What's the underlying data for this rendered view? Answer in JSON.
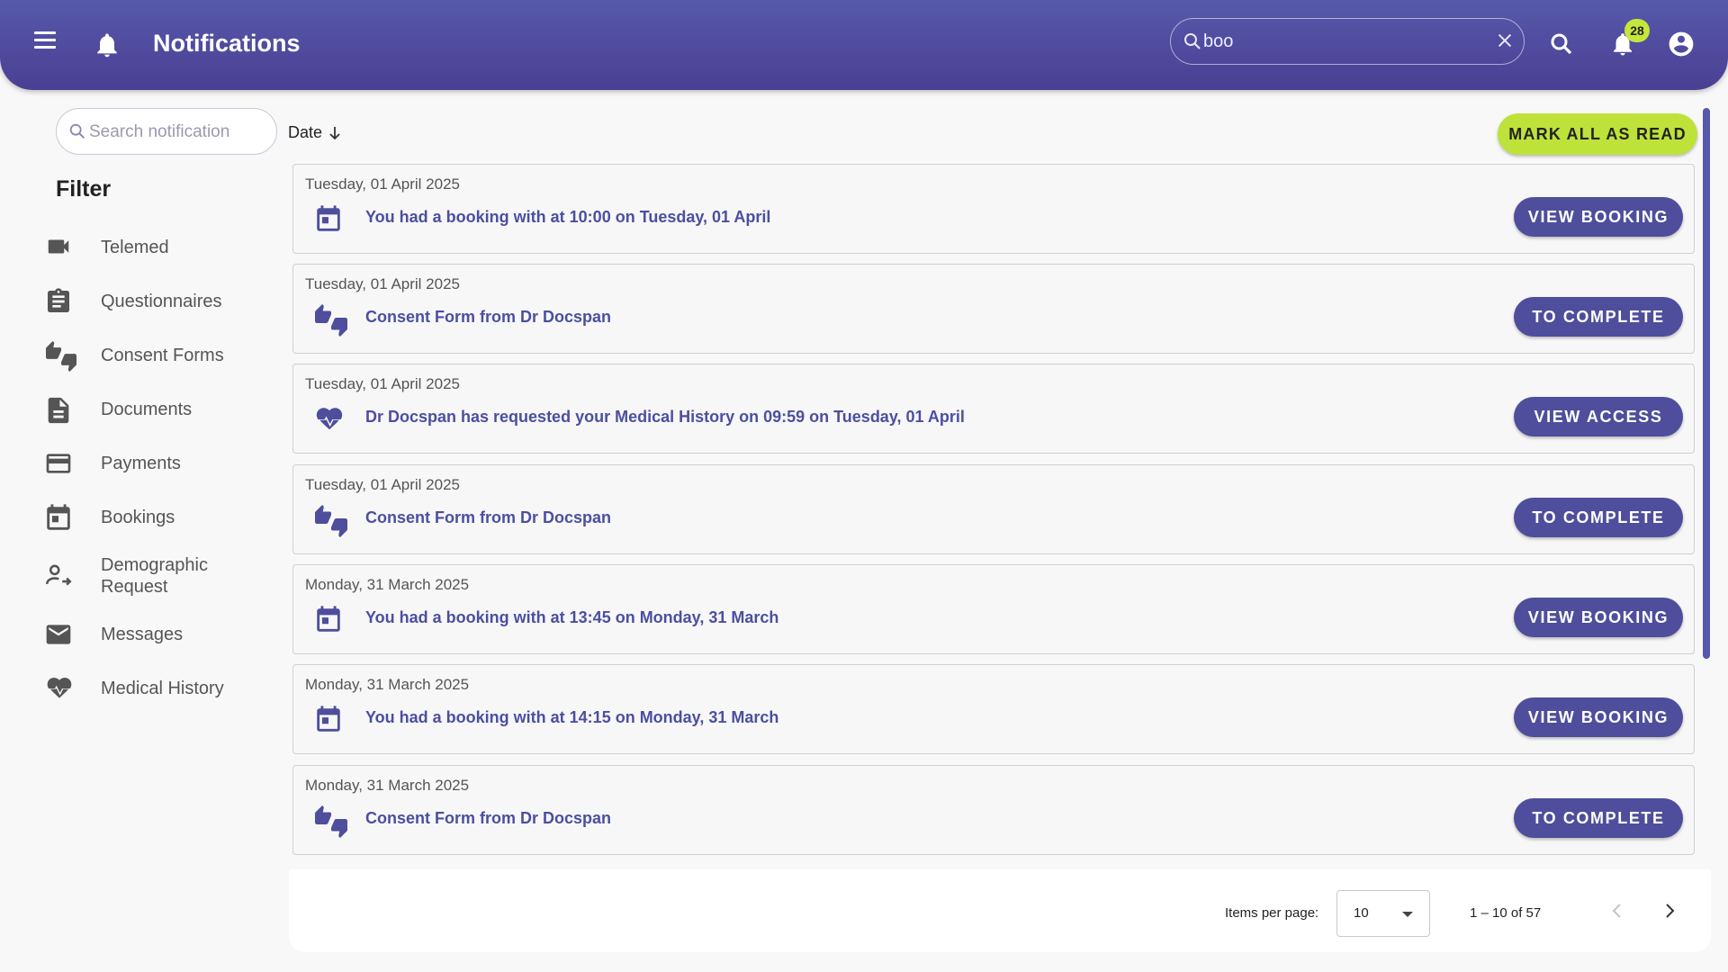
{
  "header": {
    "title": "Notifications",
    "search_value": "boo",
    "notification_count": "28",
    "icons": [
      "menu-icon",
      "bell-icon",
      "search-icon",
      "close-icon",
      "notifications-bell-icon",
      "account-circle-icon"
    ]
  },
  "sidebar": {
    "search_placeholder": "Search notification",
    "filter_title": "Filter",
    "items": [
      {
        "label": "Telemed",
        "icon": "video-camera-icon"
      },
      {
        "label": "Questionnaires",
        "icon": "clipboard-icon"
      },
      {
        "label": "Consent Forms",
        "icon": "thumbs-up-down-icon"
      },
      {
        "label": "Documents",
        "icon": "document-icon"
      },
      {
        "label": "Payments",
        "icon": "credit-card-icon"
      },
      {
        "label": "Bookings",
        "icon": "calendar-icon"
      },
      {
        "label": "Demographic Request",
        "icon": "person-arrow-icon"
      },
      {
        "label": "Messages",
        "icon": "envelope-icon"
      },
      {
        "label": "Medical History",
        "icon": "heart-pulse-icon"
      }
    ]
  },
  "toolbar": {
    "sort_label": "Date",
    "mark_all_label": "MARK ALL AS READ"
  },
  "notifications": [
    {
      "date": "Tuesday, 01 April 2025",
      "message": "You had a booking with at 10:00 on Tuesday, 01 April",
      "action": "VIEW BOOKING",
      "icon": "calendar-icon"
    },
    {
      "date": "Tuesday, 01 April 2025",
      "message": "Consent Form from Dr Docspan",
      "action": "TO COMPLETE",
      "icon": "thumbs-up-down-icon"
    },
    {
      "date": "Tuesday, 01 April 2025",
      "message": "Dr Docspan has requested your Medical History on 09:59 on Tuesday, 01 April",
      "action": "VIEW ACCESS",
      "icon": "heart-pulse-icon"
    },
    {
      "date": "Tuesday, 01 April 2025",
      "message": "Consent Form from Dr Docspan",
      "action": "TO COMPLETE",
      "icon": "thumbs-up-down-icon"
    },
    {
      "date": "Monday, 31 March 2025",
      "message": "You had a booking with at 13:45 on Monday, 31 March",
      "action": "VIEW BOOKING",
      "icon": "calendar-icon"
    },
    {
      "date": "Monday, 31 March 2025",
      "message": "You had a booking with at 14:15 on Monday, 31 March",
      "action": "VIEW BOOKING",
      "icon": "calendar-icon"
    },
    {
      "date": "Monday, 31 March 2025",
      "message": "Consent Form from Dr Docspan",
      "action": "TO COMPLETE",
      "icon": "thumbs-up-down-icon"
    }
  ],
  "paginator": {
    "items_per_page_label": "Items per page:",
    "items_per_page_value": "10",
    "range_label": "1 – 10 of 57"
  },
  "colors": {
    "brand": "#4e4e9c",
    "header": "#5659ab",
    "accent": "#bfe23a"
  }
}
